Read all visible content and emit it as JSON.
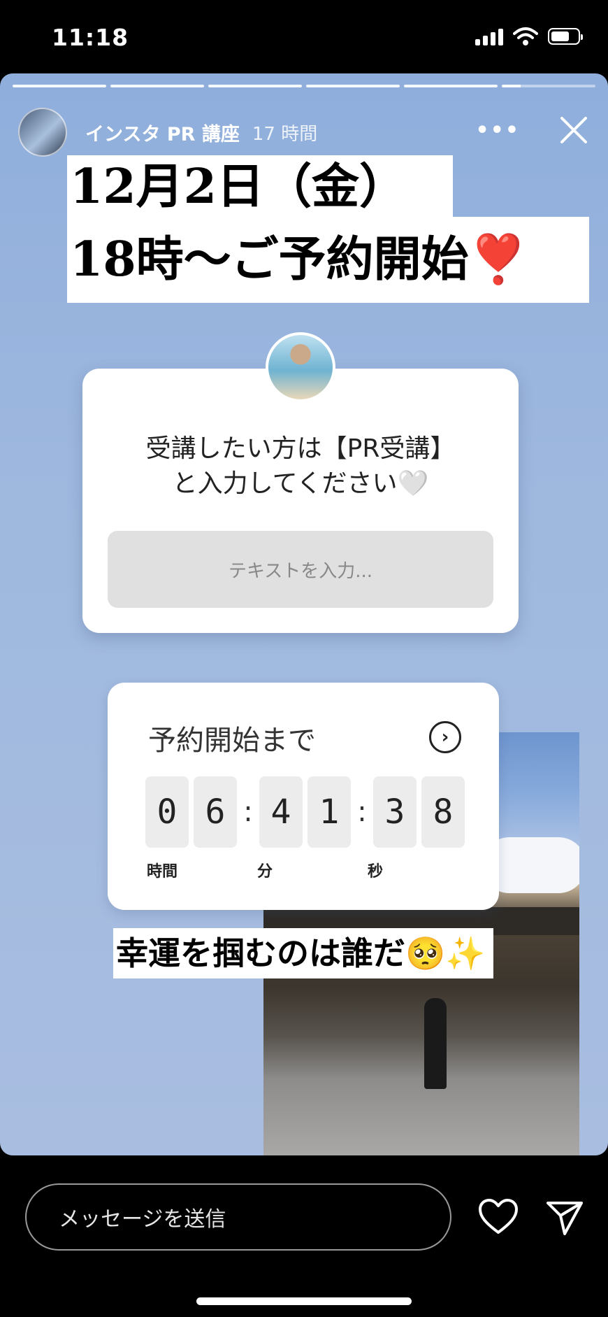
{
  "status_bar": {
    "time": "11:18",
    "icons": [
      "signal-icon",
      "wifi-icon",
      "battery-icon"
    ]
  },
  "story": {
    "progress_segments": 6,
    "account_name": "インスタ PR 講座",
    "time_ago": "17 時間",
    "more_label": "•••",
    "headline_line1": "12月2日（金）",
    "headline_line2": "18時〜ご予約開始",
    "headline_line2_emoji": "❣️",
    "question_sticker": {
      "prompt_line1": "受講したい方は【PR受講】",
      "prompt_line2": "と入力してください🤍",
      "input_placeholder": "テキストを入力..."
    },
    "countdown_sticker": {
      "title": "予約開始まで",
      "digits": [
        "0",
        "6",
        "4",
        "1",
        "3",
        "8"
      ],
      "labels": {
        "hours": "時間",
        "minutes": "分",
        "seconds": "秒"
      }
    },
    "caption": "幸運を掴むのは誰だ🥺✨"
  },
  "footer": {
    "message_placeholder": "メッセージを送信"
  },
  "colors": {
    "story_bg": "#9db7de",
    "heart_emoji": "#d81f2b"
  }
}
